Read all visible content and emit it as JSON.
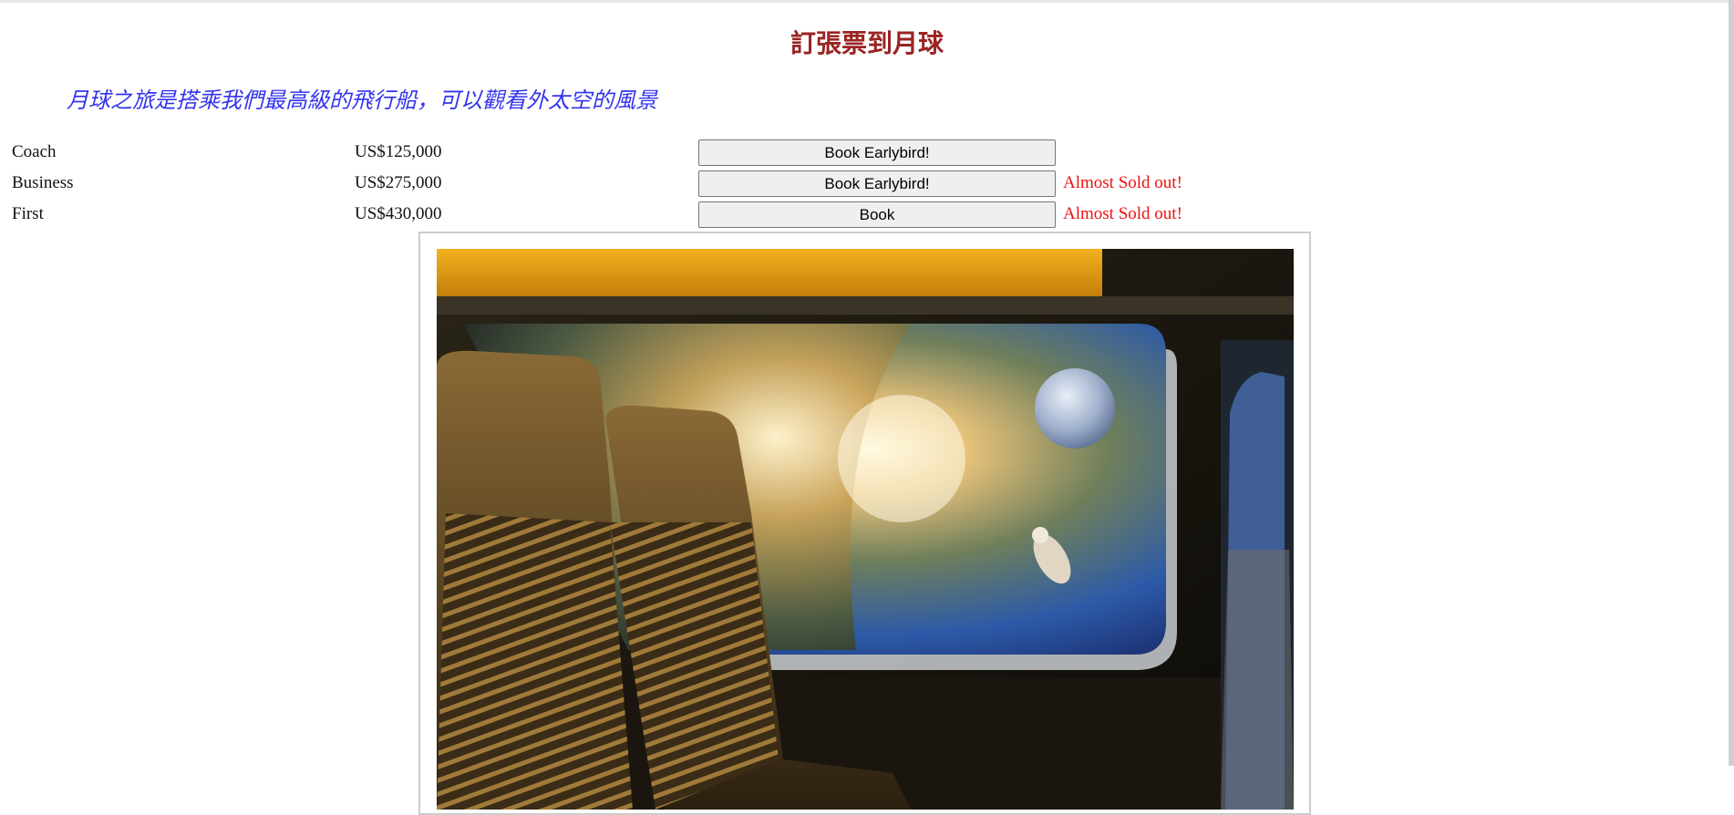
{
  "page": {
    "title": "訂張票到月球",
    "subtitle": "月球之旅是搭乘我們最高級的飛行船，可以觀看外太空的風景"
  },
  "tickets": [
    {
      "class": "Coach",
      "price": "US$125,000",
      "button": "Book Earlybird!",
      "note": ""
    },
    {
      "class": "Business",
      "price": "US$275,000",
      "button": "Book Earlybird!",
      "note": "Almost Sold out!"
    },
    {
      "class": "First",
      "price": "US$430,000",
      "button": "Book",
      "note": "Almost Sold out!"
    }
  ],
  "colors": {
    "title": "#9a2323",
    "subtitle": "#3333ee",
    "alert": "#ee1111"
  }
}
